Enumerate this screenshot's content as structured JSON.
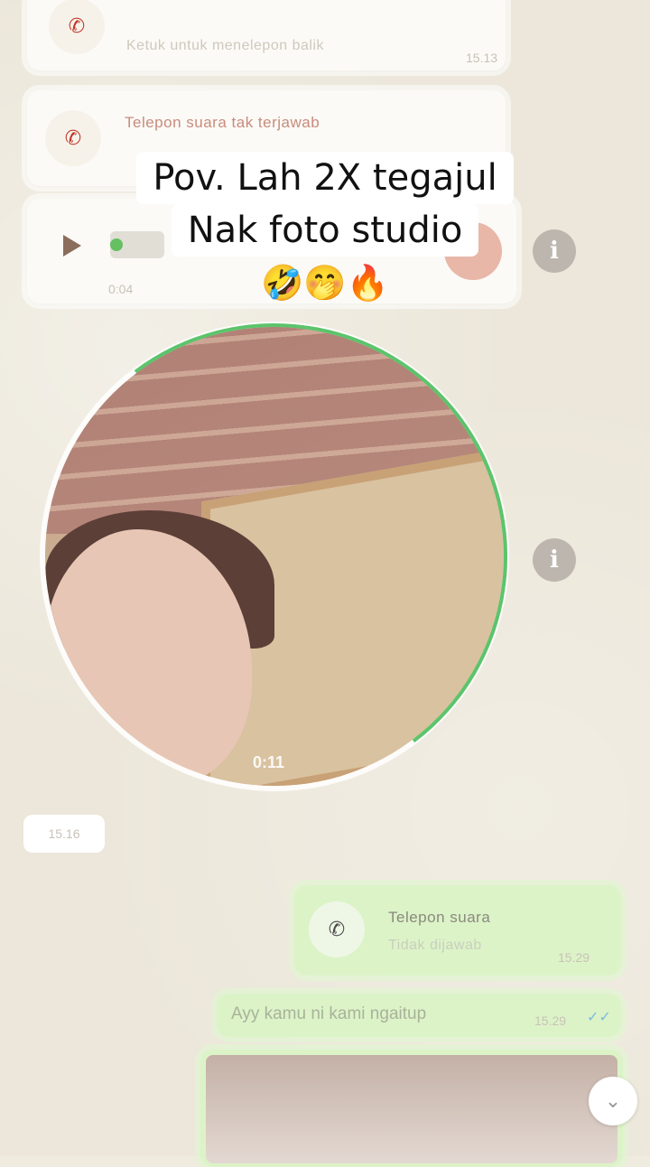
{
  "messages": {
    "call1": {
      "title": "",
      "subtitle": "Ketuk untuk menelepon balik",
      "time": "15.13"
    },
    "call2": {
      "title": "Telepon suara tak terjawab",
      "subtitle": ""
    },
    "voice": {
      "duration": "0:04"
    },
    "video_note": {
      "duration": "0:11"
    },
    "date_label": "15.16",
    "out_call": {
      "title": "Telepon suara",
      "subtitle": "Tidak dijawab",
      "time": "15.29"
    },
    "out_text": {
      "text": "Ayy kamu ni kami ngaitup",
      "time": "15.29"
    }
  },
  "caption": {
    "line1": "Pov. Lah 2X tegajul",
    "line2": "Nak foto studio",
    "line3": "🤣🤭🔥"
  },
  "icons": {
    "missed_call": "missed-call-icon",
    "outgoing_call": "outgoing-call-icon",
    "info": "info-icon",
    "scroll_down": "chevron-down-icon"
  },
  "colors": {
    "accent": "#5cc46b",
    "missed": "#c0392b",
    "outgoing_bubble": "#dcf3c8"
  }
}
